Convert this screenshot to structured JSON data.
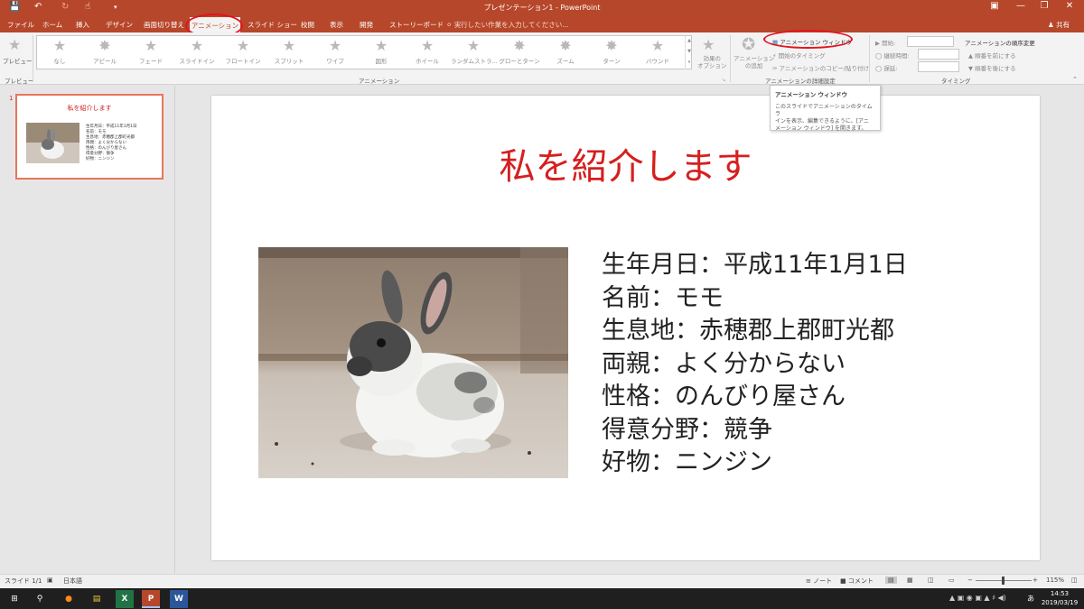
{
  "window": {
    "title": "プレゼンテーション1 - PowerPoint",
    "quick_access": [
      "save-icon",
      "undo-icon",
      "redo-icon",
      "touch-mode-icon",
      "customize-icon"
    ]
  },
  "tabs": [
    "ファイル",
    "ホーム",
    "挿入",
    "デザイン",
    "画面切り替え",
    "アニメーション",
    "スライド ショー",
    "校閲",
    "表示",
    "開発",
    "ストーリーボード"
  ],
  "active_tab": "アニメーション",
  "tell_me": "実行したい作業を入力してください...",
  "share": "共有",
  "ribbon": {
    "preview_label": "プレビュー",
    "preview_group": "プレビュー",
    "gallery_items": [
      "なし",
      "アピール",
      "フェード",
      "スライドイン",
      "フロートイン",
      "スプリット",
      "ワイプ",
      "図形",
      "ホイール",
      "ランダムストラ...",
      "グローとターン",
      "ズーム",
      "ターン",
      "バウンド"
    ],
    "effect_options_1": "効果の",
    "effect_options_2": "オプション",
    "animation_group": "アニメーション",
    "add_animation_1": "アニメーション",
    "add_animation_2": "の追加",
    "animation_pane": "アニメーション ウィンドウ",
    "trigger": "開始のタイミング",
    "painter": "アニメーションのコピー/貼り付け",
    "advanced_group": "アニメーションの詳細設定",
    "start_label": "開始:",
    "duration_label": "継続時間:",
    "delay_label": "遅延:",
    "reorder_title": "アニメーションの順序変更",
    "move_earlier": "順番を前にする",
    "move_later": "順番を後にする",
    "timing_group": "タイミング"
  },
  "tooltip": {
    "title": "アニメーション ウィンドウ",
    "line1": "このスライドでアニメーションのタイムラ",
    "line2": "インを表示、編集できるように、[アニ",
    "line3": "メーション ウィンドウ] を開きます。"
  },
  "thumbnail": {
    "number": "1",
    "title": "私を紹介します",
    "lines": [
      "生年月日：平成11年1月1日",
      "名前：モモ",
      "生息地：赤穂郡上郡町光都",
      "両親：よく分からない",
      "性格：のんびり屋さん",
      "得意分野：競争",
      "好物：ニンジン"
    ]
  },
  "slide": {
    "title": "私を紹介します",
    "bullets": [
      "生年月日：平成11年1月1日",
      "名前：モモ",
      "生息地：赤穂郡上郡町光都",
      "両親：よく分からない",
      "性格：のんびり屋さん",
      "得意分野：競争",
      "好物：ニンジン"
    ],
    "title_color": "#d61f1f"
  },
  "status": {
    "slide_count": "スライド 1/1",
    "language": "日本語",
    "notes": "ノート",
    "comments": "コメント",
    "zoom": "115%"
  },
  "taskbar": {
    "time": "14:53",
    "date": "2019/03/19"
  },
  "colors": {
    "accent": "#b7472a",
    "highlight_ring": "#e3131e"
  }
}
